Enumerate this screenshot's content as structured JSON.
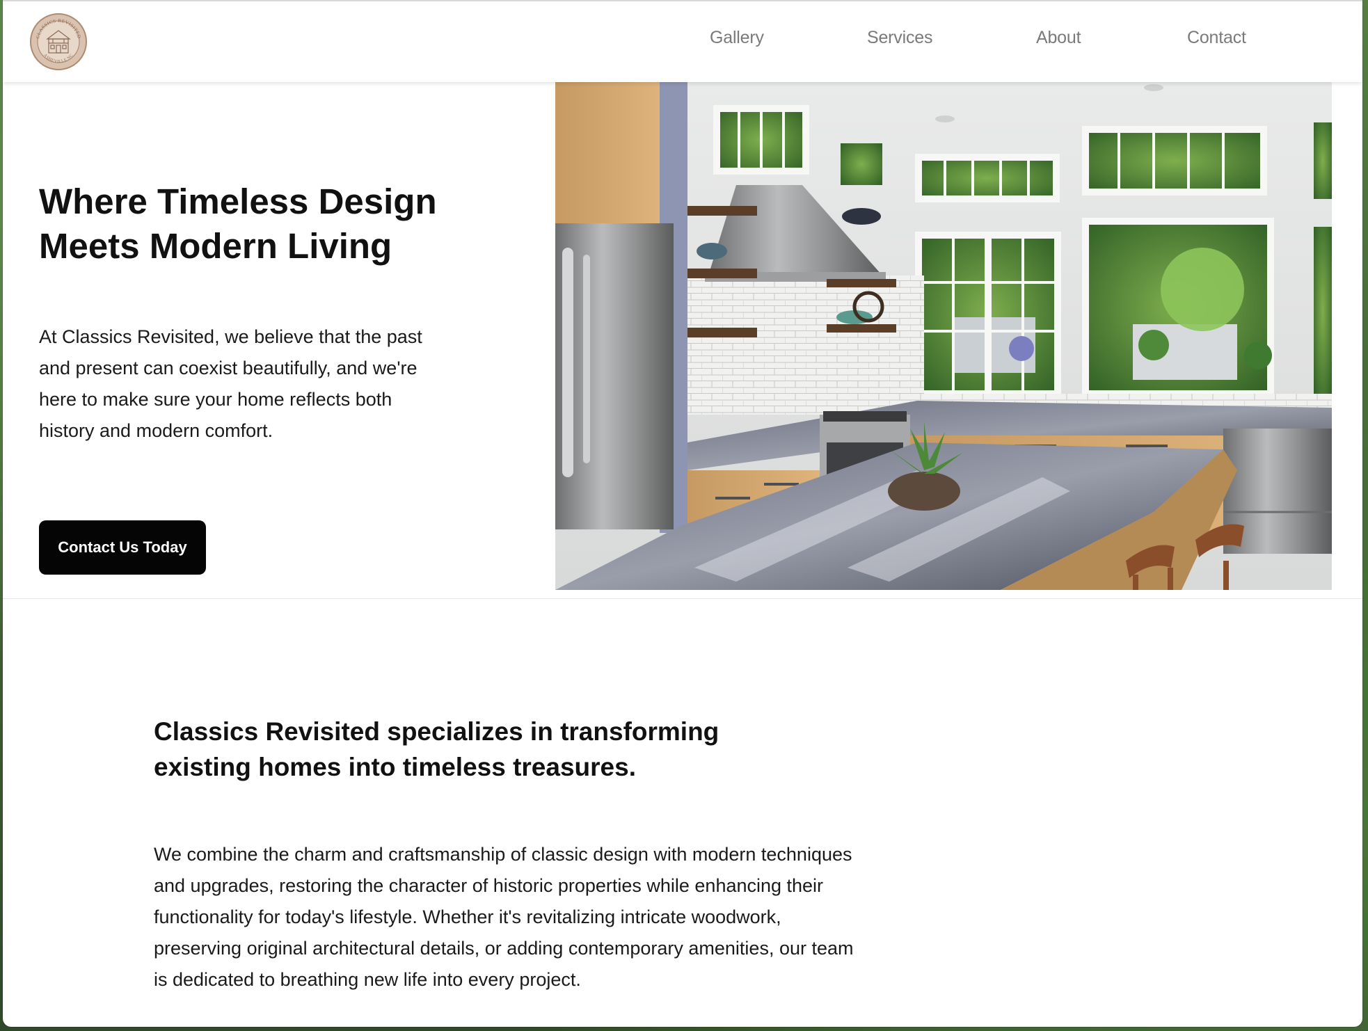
{
  "brand": {
    "logo_ring_text": "CLASSICS REVISITED",
    "logo_bottom_text": "ASHEVILLE NC",
    "logo_color": "#b08a70"
  },
  "nav": {
    "items": [
      {
        "label": "Gallery"
      },
      {
        "label": "Services"
      },
      {
        "label": "About"
      },
      {
        "label": "Contact"
      }
    ]
  },
  "hero": {
    "title": "Where Timeless Design Meets Modern Living",
    "text": "At Classics Revisited, we believe that the past and present can coexist beautifully, and we're here to make sure your home reflects both history and modern comfort.",
    "cta_label": "Contact Us Today",
    "image_subject": "kitchen-photo"
  },
  "about": {
    "title": "Classics Revisited specializes in transforming existing homes into timeless treasures.",
    "text": "We combine the charm and craftsmanship of classic design with modern techniques and upgrades, restoring the character of historic properties while enhancing their functionality for today's lifestyle. Whether it's revitalizing intricate woodwork, preserving original architectural details, or adding contemporary amenities, our team is dedicated to breathing new life into every project."
  },
  "colors": {
    "accent": "#050505",
    "nav_text": "#7a7a7a"
  }
}
